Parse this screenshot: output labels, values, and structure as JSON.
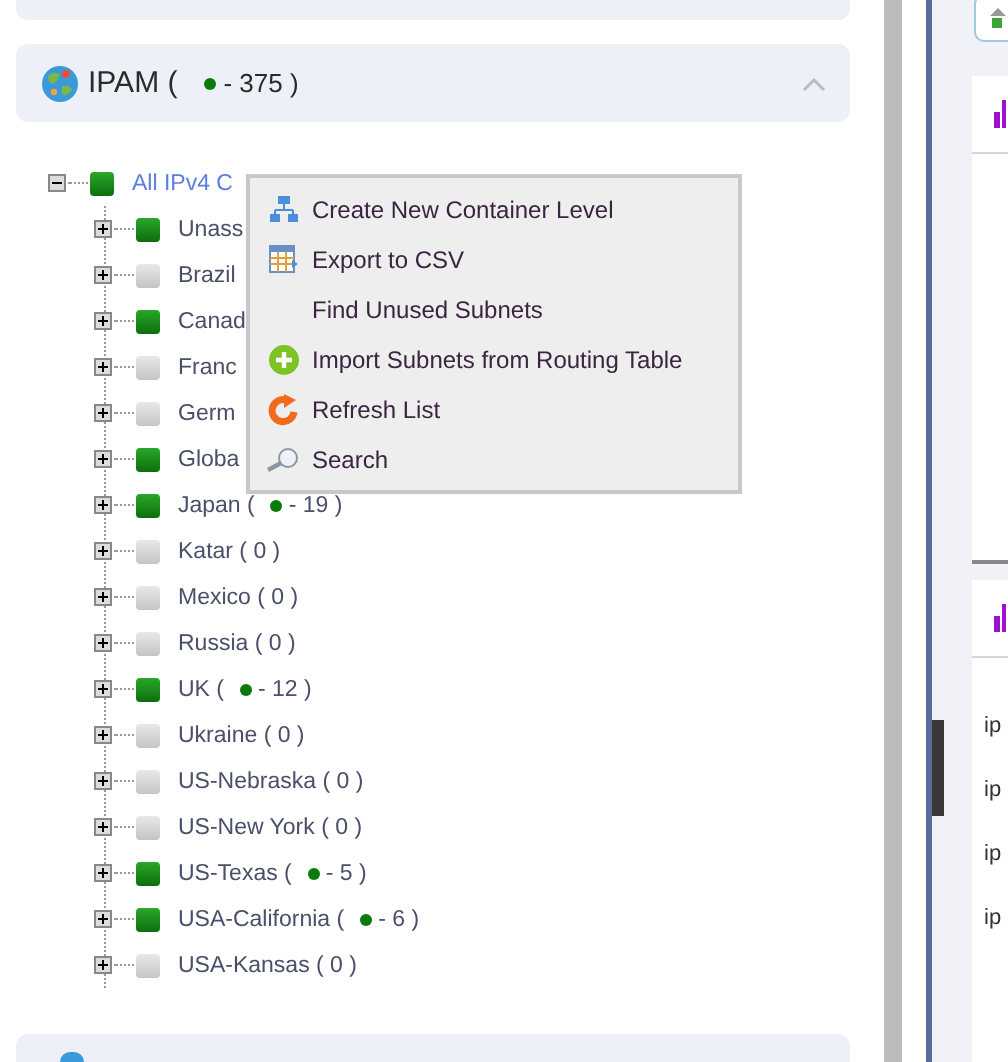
{
  "ipam": {
    "title": "IPAM (",
    "count": "- 375 )",
    "expanded": true
  },
  "tree": {
    "label": "All IPv4 C",
    "expanded": true,
    "active": true,
    "children": [
      {
        "label": "Unass",
        "active": true,
        "expanded": false
      },
      {
        "label": "Brazil",
        "active": false,
        "expanded": false
      },
      {
        "label": "Canad",
        "active": true,
        "expanded": false
      },
      {
        "label": "Franc",
        "active": false,
        "expanded": false
      },
      {
        "label": "Germ",
        "active": false,
        "expanded": false
      },
      {
        "label": "Globa",
        "active": true,
        "expanded": false
      },
      {
        "label": "Japan (",
        "count": "- 19 )",
        "active": true,
        "expanded": false
      },
      {
        "label": "Katar ( 0 )",
        "active": false,
        "expanded": false
      },
      {
        "label": "Mexico ( 0 )",
        "active": false,
        "expanded": false
      },
      {
        "label": "Russia ( 0 )",
        "active": false,
        "expanded": false
      },
      {
        "label": "UK (",
        "count": "- 12 )",
        "active": true,
        "expanded": false
      },
      {
        "label": "Ukraine ( 0 )",
        "active": false,
        "expanded": false
      },
      {
        "label": "US-Nebraska ( 0 )",
        "active": false,
        "expanded": false
      },
      {
        "label": "US-New York ( 0 )",
        "active": false,
        "expanded": false
      },
      {
        "label": "US-Texas (",
        "count": "- 5 )",
        "active": true,
        "expanded": false
      },
      {
        "label": "USA-California (",
        "count": "- 6 )",
        "active": true,
        "expanded": false
      },
      {
        "label": "USA-Kansas ( 0 )",
        "active": false,
        "expanded": false
      }
    ]
  },
  "context_menu": [
    {
      "kind": "hierarchy",
      "label": "Create New Container Level"
    },
    {
      "kind": "table",
      "label": "Export to CSV"
    },
    {
      "kind": "none",
      "label": "Find Unused Subnets"
    },
    {
      "kind": "add",
      "label": "Import Subnets from Routing Table"
    },
    {
      "kind": "refresh",
      "label": "Refresh List"
    },
    {
      "kind": "search",
      "label": "Search"
    }
  ],
  "right_panel": {
    "list": [
      "ip",
      "ip",
      "ip",
      "ip"
    ]
  }
}
